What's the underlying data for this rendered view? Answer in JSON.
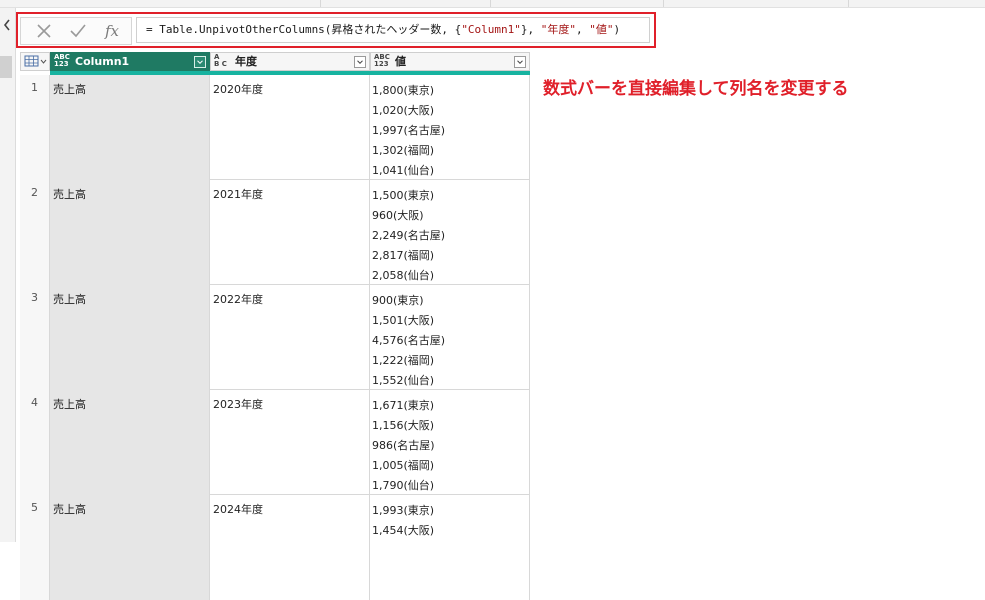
{
  "formula_bar": {
    "prefix": "= Table.UnpivotOtherColumns(昇格されたヘッダー数, {",
    "col_str": "\"Column1\"",
    "middle": "}, ",
    "attr_str": "\"年度\"",
    "comma": ", ",
    "value_str": "\"値\"",
    "suffix": ")",
    "fx_label": "fx"
  },
  "columns": [
    {
      "type_top": "ABC",
      "type_bottom": "123",
      "title": "Column1",
      "selected": true
    },
    {
      "type_top": "A",
      "type_bottom": "B C",
      "title": "年度",
      "selected": false
    },
    {
      "type_top": "ABC",
      "type_bottom": "123",
      "title": "値",
      "selected": false
    }
  ],
  "rows": [
    {
      "num": "1",
      "c1": "売上高",
      "c2": "2020年度",
      "values": [
        "1,800(東京)",
        "1,020(大阪)",
        "1,997(名古屋)",
        "1,302(福岡)",
        "1,041(仙台)"
      ]
    },
    {
      "num": "2",
      "c1": "売上高",
      "c2": "2021年度",
      "values": [
        "1,500(東京)",
        "960(大阪)",
        "2,249(名古屋)",
        "2,817(福岡)",
        "2,058(仙台)"
      ]
    },
    {
      "num": "3",
      "c1": "売上高",
      "c2": "2022年度",
      "values": [
        "900(東京)",
        "1,501(大阪)",
        "4,576(名古屋)",
        "1,222(福岡)",
        "1,552(仙台)"
      ]
    },
    {
      "num": "4",
      "c1": "売上高",
      "c2": "2023年度",
      "values": [
        "1,671(東京)",
        "1,156(大阪)",
        "986(名古屋)",
        "1,005(福岡)",
        "1,790(仙台)"
      ]
    },
    {
      "num": "5",
      "c1": "売上高",
      "c2": "2024年度",
      "values": [
        "1,993(東京)",
        "1,454(大阪)"
      ]
    }
  ],
  "annotation": "数式バーを直接編集して列名を変更する",
  "colors": {
    "accent_red": "#e0202a",
    "header_green": "#1f7a63",
    "teal_bar": "#17b3a0"
  }
}
